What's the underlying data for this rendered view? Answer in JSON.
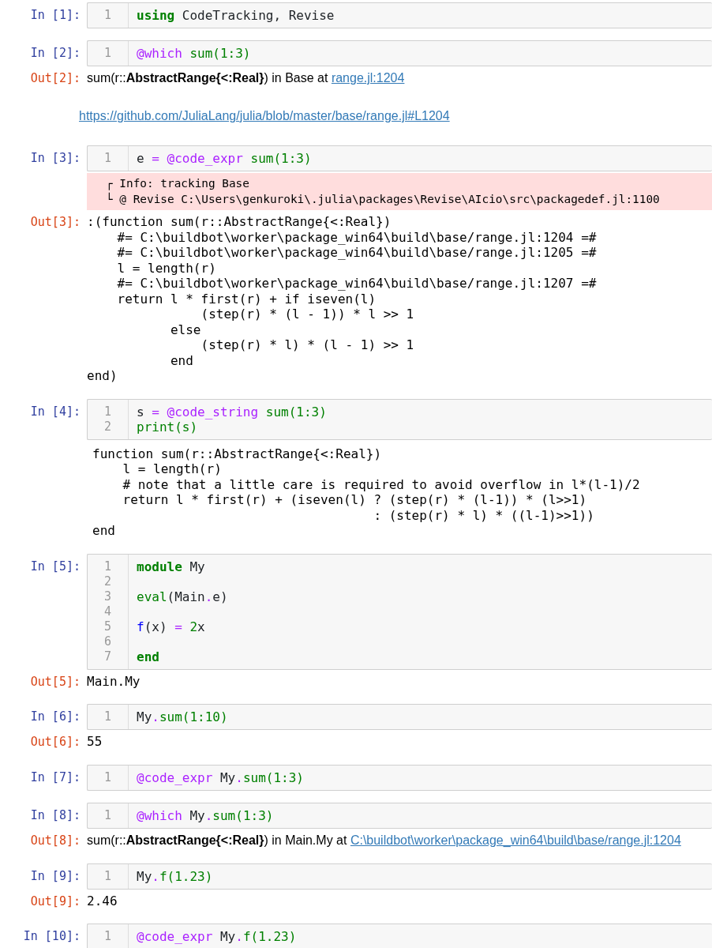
{
  "cells": [
    {
      "prompt": "In [1]:",
      "lines": [
        {
          "number": "1",
          "tokens": [
            {
              "kind": "keyword",
              "text": "using"
            },
            {
              "kind": "plain",
              "text": " CodeTracking, Revise"
            }
          ]
        }
      ]
    },
    {
      "prompt": "In [2]:",
      "lines": [
        {
          "number": "1",
          "tokens": [
            {
              "kind": "macro",
              "text": "@which"
            },
            {
              "kind": "builtin",
              "text": " sum(1:3)"
            }
          ]
        }
      ],
      "outputs": [
        {
          "kind": "rich",
          "prompt": "Out[2]:",
          "text": "sum(r::**AbstractRange{<:Real}**) in Base at ",
          "link": "range.jl:1204"
        },
        {
          "kind": "link",
          "link": "https://github.com/JuliaLang/julia/blob/master/base/range.jl#L1204"
        }
      ]
    },
    {
      "prompt": "In [3]:",
      "lines": [
        {
          "number": "1",
          "tokens": [
            {
              "kind": "plain",
              "text": "e "
            },
            {
              "kind": "operator",
              "text": "= "
            },
            {
              "kind": "macro",
              "text": "@code_expr"
            },
            {
              "kind": "builtin",
              "text": " sum(1:3)"
            }
          ]
        }
      ],
      "outputs": [
        {
          "kind": "stderr",
          "lines": [
            "┌ Info: tracking Base",
            "└ @ Revise C:\\Users\\genkuroki\\.julia\\packages\\Revise\\AIcio\\src\\packagedef.jl:1100"
          ]
        },
        {
          "kind": "text",
          "prompt": "Out[3]:",
          "lines": [
            ":(function sum(r::AbstractRange{<:Real})",
            "    #= C:\\buildbot\\worker\\package_win64\\build\\base/range.jl:1204 =#",
            "    #= C:\\buildbot\\worker\\package_win64\\build\\base/range.jl:1205 =#",
            "    l = length(r)",
            "    #= C:\\buildbot\\worker\\package_win64\\build\\base/range.jl:1207 =#",
            "    return l * first(r) + if iseven(l)",
            "               (step(r) * (l - 1)) * l >> 1",
            "           else",
            "               (step(r) * l) * (l - 1) >> 1",
            "           end",
            "end)"
          ]
        }
      ]
    },
    {
      "prompt": "In [4]:",
      "lines": [
        {
          "number": "1",
          "tokens": [
            {
              "kind": "plain",
              "text": "s "
            },
            {
              "kind": "operator",
              "text": "= "
            },
            {
              "kind": "macro",
              "text": "@code_string"
            },
            {
              "kind": "builtin",
              "text": " sum(1:3)"
            }
          ]
        },
        {
          "number": "2",
          "tokens": [
            {
              "kind": "builtin",
              "text": "print(s)"
            }
          ]
        }
      ],
      "outputs": [
        {
          "kind": "stdout",
          "lines": [
            "function sum(r::AbstractRange{<:Real})",
            "    l = length(r)",
            "    # note that a little care is required to avoid overflow in l*(l-1)/2",
            "    return l * first(r) + (iseven(l) ? (step(r) * (l-1)) * (l>>1)",
            "                                     : (step(r) * l) * ((l-1)>>1))",
            "end"
          ]
        }
      ]
    },
    {
      "prompt": "In [5]:",
      "lines": [
        {
          "number": "1",
          "tokens": [
            {
              "kind": "keyword",
              "text": "module"
            },
            {
              "kind": "plain",
              "text": " My"
            }
          ]
        },
        {
          "number": "2"
        },
        {
          "number": "3",
          "tokens": [
            {
              "kind": "builtin",
              "text": "eval"
            },
            {
              "kind": "plain",
              "text": "(Main"
            },
            {
              "kind": "operator",
              "text": "."
            },
            {
              "kind": "plain",
              "text": "e)"
            }
          ]
        },
        {
          "number": "4"
        },
        {
          "number": "5",
          "tokens": [
            {
              "kind": "function",
              "text": "f"
            },
            {
              "kind": "plain",
              "text": "(x) "
            },
            {
              "kind": "operator",
              "text": "= "
            },
            {
              "kind": "builtin",
              "text": "2"
            },
            {
              "kind": "plain",
              "text": "x"
            }
          ]
        },
        {
          "number": "6"
        },
        {
          "number": "7",
          "tokens": [
            {
              "kind": "keyword",
              "text": "end"
            }
          ]
        }
      ],
      "outputs": [
        {
          "kind": "text",
          "prompt": "Out[5]:",
          "lines": [
            "Main.My"
          ]
        }
      ]
    },
    {
      "prompt": "In [6]:",
      "lines": [
        {
          "number": "1",
          "tokens": [
            {
              "kind": "plain",
              "text": "My"
            },
            {
              "kind": "operator",
              "text": "."
            },
            {
              "kind": "builtin",
              "text": "sum(1:10)"
            }
          ]
        }
      ],
      "outputs": [
        {
          "kind": "text",
          "prompt": "Out[6]:",
          "lines": [
            "55"
          ]
        }
      ]
    },
    {
      "prompt": "In [7]:",
      "lines": [
        {
          "number": "1",
          "tokens": [
            {
              "kind": "macro",
              "text": "@code_expr"
            },
            {
              "kind": "plain",
              "text": " My"
            },
            {
              "kind": "operator",
              "text": "."
            },
            {
              "kind": "builtin",
              "text": "sum(1:3)"
            }
          ]
        }
      ]
    },
    {
      "prompt": "In [8]:",
      "lines": [
        {
          "number": "1",
          "tokens": [
            {
              "kind": "macro",
              "text": "@which"
            },
            {
              "kind": "plain",
              "text": " My"
            },
            {
              "kind": "operator",
              "text": "."
            },
            {
              "kind": "builtin",
              "text": "sum(1:3)"
            }
          ]
        }
      ],
      "outputs": [
        {
          "kind": "rich",
          "prompt": "Out[8]:",
          "text": "sum(r::**AbstractRange{<:Real}**) in Main.My at ",
          "link": "C:\\buildbot\\worker\\package_win64\\build\\base/range.jl:1204"
        }
      ]
    },
    {
      "prompt": "In [9]:",
      "lines": [
        {
          "number": "1",
          "tokens": [
            {
              "kind": "plain",
              "text": "My"
            },
            {
              "kind": "operator",
              "text": "."
            },
            {
              "kind": "builtin",
              "text": "f(1.23)"
            }
          ]
        }
      ],
      "outputs": [
        {
          "kind": "text",
          "prompt": "Out[9]:",
          "lines": [
            "2.46"
          ]
        }
      ]
    },
    {
      "prompt": "In [10]:",
      "lines": [
        {
          "number": "1",
          "tokens": [
            {
              "kind": "macro",
              "text": "@code_expr"
            },
            {
              "kind": "plain",
              "text": " My"
            },
            {
              "kind": "operator",
              "text": "."
            },
            {
              "kind": "builtin",
              "text": "f(1.23)"
            }
          ]
        }
      ]
    }
  ]
}
